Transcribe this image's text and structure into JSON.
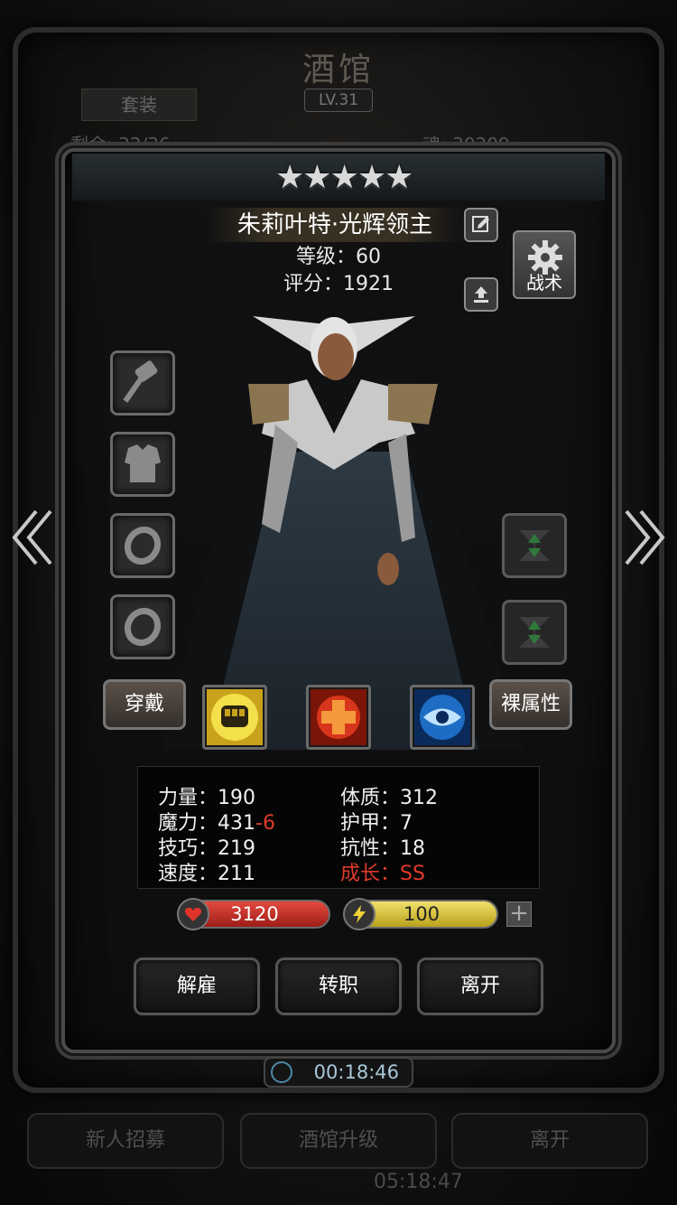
{
  "background": {
    "title": "酒馆",
    "level": "LV.31",
    "suit_tab": "套装",
    "recruits": "剩余: 32/36",
    "souls": "魂: 30209",
    "timer2": "05:18:47",
    "buttons": [
      "新人招募",
      "酒馆升级",
      "离开"
    ]
  },
  "hero": {
    "stars": "★★★★★",
    "name": "朱莉叶特·光辉领主",
    "level": "等级：60",
    "score": "评分：1921"
  },
  "tactics_label": "战术",
  "equipment": [
    "hammer-icon",
    "armor-icon",
    "ring-icon",
    "ring-icon"
  ],
  "buttons": {
    "wear": "穿戴",
    "bare_attributes": "裸属性",
    "dismiss": "解雇",
    "transfer": "转职",
    "leave": "离开"
  },
  "skills": [
    "fist-icon",
    "heal-cross-icon",
    "eye-icon"
  ],
  "stats": {
    "strength": "力量：190",
    "magic": "魔力：431",
    "magic_delta": "-6",
    "skill": "技巧：219",
    "speed": "速度：211",
    "constitution": "体质：312",
    "armor": "护甲：7",
    "resistance": "抗性：18",
    "growth": "成长：SS"
  },
  "hp": "3120",
  "energy": "100",
  "timer": "00:18:46",
  "colors": {
    "hp_red": "#e03a2a",
    "energy_yellow": "#e6d34a",
    "growth_red": "#e03a2a"
  }
}
